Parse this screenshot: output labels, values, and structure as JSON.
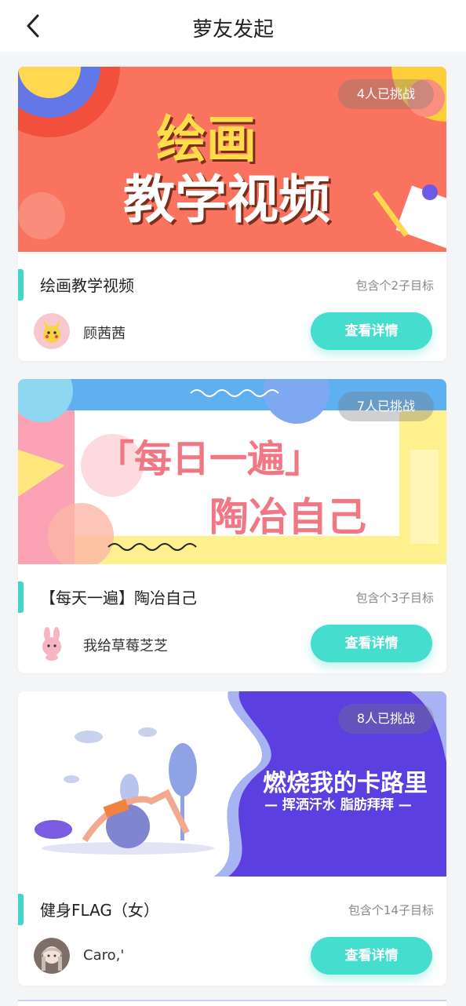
{
  "header": {
    "title": "萝友发起"
  },
  "cards": [
    {
      "badge": "4人已挑战",
      "banner_line1": "绘画",
      "banner_line2": "教学视频",
      "title": "绘画教学视频",
      "goals": "包含个2子目标",
      "user": "顾茜茜",
      "button": "查看详情"
    },
    {
      "badge": "7人已挑战",
      "banner_line1": "「每日一遍」",
      "banner_line2": "陶冶自己",
      "title": "【每天一遍】陶冶自己",
      "goals": "包含个3子目标",
      "user": "我给草莓芝芝",
      "button": "查看详情"
    },
    {
      "badge": "8人已挑战",
      "banner_line1": "燃烧我的卡路里",
      "banner_line2": "— 挥洒汗水 脂肪拜拜 —",
      "title": "健身FLAG（女）",
      "goals": "包含个14子目标",
      "user": "Caro,'",
      "button": "查看详情"
    }
  ],
  "colors": {
    "accent": "#3ed9c8",
    "button": "#45ddcd"
  }
}
